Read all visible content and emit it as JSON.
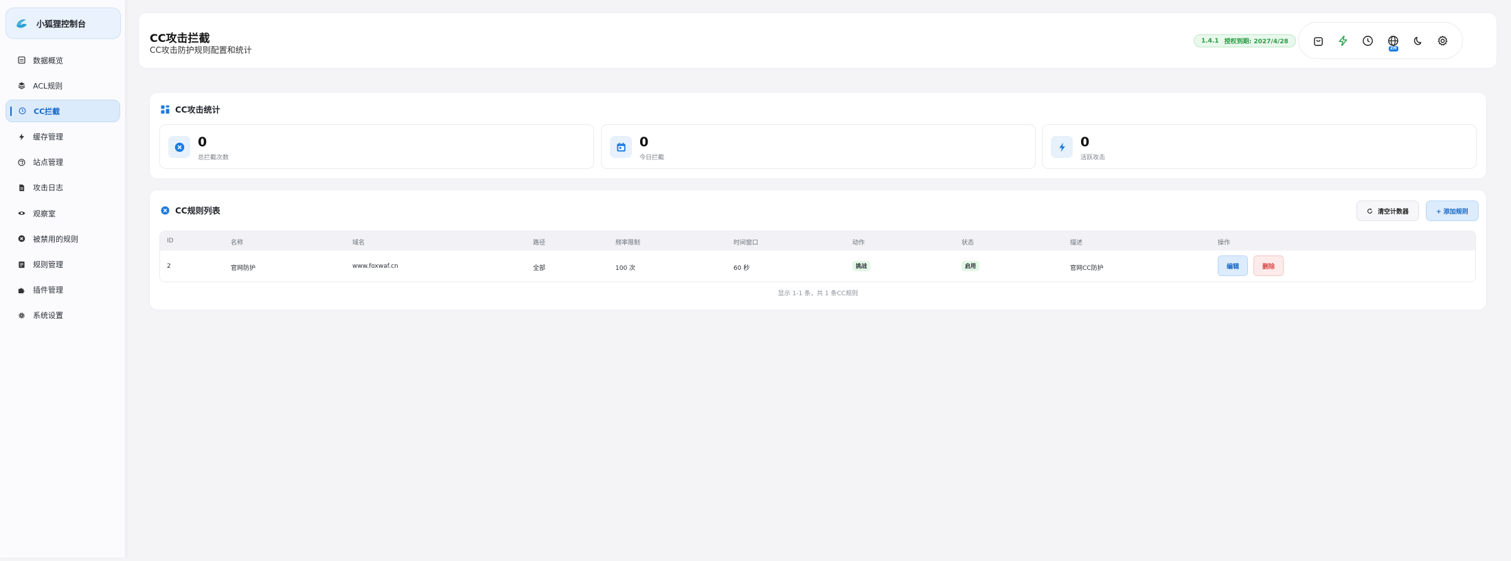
{
  "sidebar": {
    "brand": "小狐狸控制台",
    "items": [
      {
        "label": "数据概览",
        "icon": "dashboard-icon"
      },
      {
        "label": "ACL规则",
        "icon": "layers-icon"
      },
      {
        "label": "CC拦截",
        "icon": "clock-shield-icon",
        "active": true
      },
      {
        "label": "缓存管理",
        "icon": "bolt-icon"
      },
      {
        "label": "站点管理",
        "icon": "globe-icon"
      },
      {
        "label": "攻击日志",
        "icon": "file-icon"
      },
      {
        "label": "观察室",
        "icon": "eye-icon"
      },
      {
        "label": "被禁用的规则",
        "icon": "x-circle-icon"
      },
      {
        "label": "规则管理",
        "icon": "document-icon"
      },
      {
        "label": "插件管理",
        "icon": "puzzle-icon"
      },
      {
        "label": "系统设置",
        "icon": "gear-icon"
      }
    ]
  },
  "header": {
    "title": "CC攻击拦截",
    "subtitle": "CC攻击防护规则配置和统计",
    "version": "1.4.1",
    "license": "授权到期: 2027/4/28",
    "lang": "ZH",
    "accent": "#1c7be0"
  },
  "stats": {
    "title": "CC攻击统计",
    "cards": [
      {
        "value": "0",
        "label": "总拦截次数"
      },
      {
        "value": "0",
        "label": "今日拦截"
      },
      {
        "value": "0",
        "label": "活跃攻击"
      }
    ]
  },
  "rules": {
    "title": "CC规则列表",
    "clear_button": "清空计数器",
    "add_button": "+ 添加规则",
    "columns": [
      "ID",
      "名称",
      "域名",
      "路径",
      "频率限制",
      "时间窗口",
      "动作",
      "状态",
      "描述",
      "操作"
    ],
    "rows": [
      {
        "id": "2",
        "name": "官网防护",
        "domain": "www.foxwaf.cn",
        "path": "全部",
        "rate": "100 次",
        "window": "60 秒",
        "action": "挑战",
        "status": "启用",
        "desc": "官网CC防护",
        "edit": "编辑",
        "delete": "删除"
      }
    ],
    "summary": "显示 1-1 条，共 1 条CC规则"
  }
}
